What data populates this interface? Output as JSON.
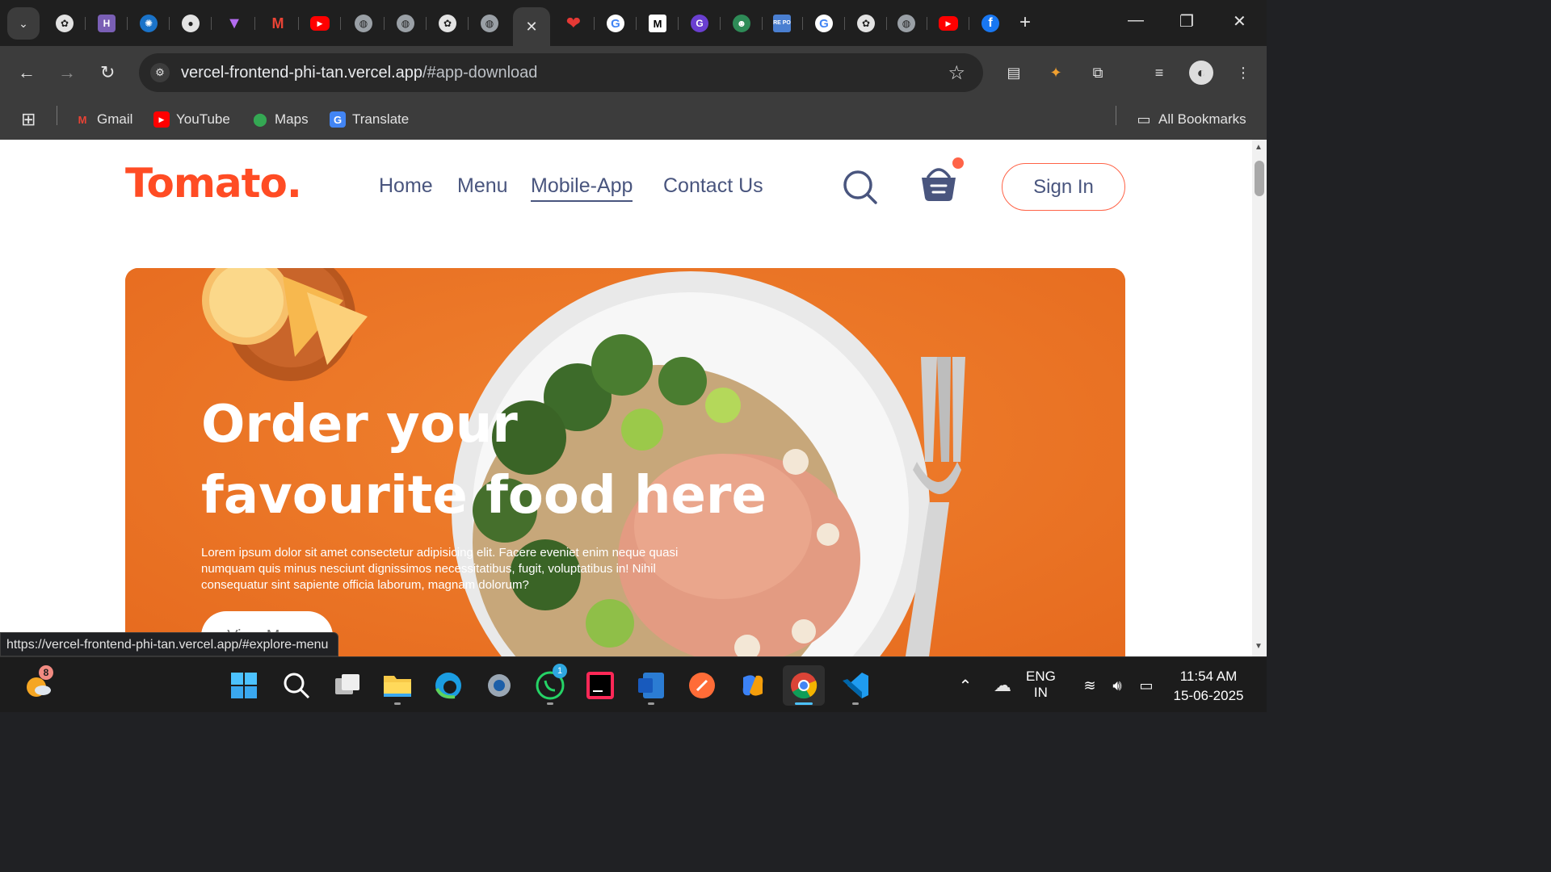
{
  "browser": {
    "tabs": [
      {
        "icon": "chatgpt-icon",
        "label": ""
      },
      {
        "icon": "hostinger-icon",
        "label": "H"
      },
      {
        "icon": "blue-circle-icon",
        "label": ""
      },
      {
        "icon": "github-icon",
        "label": ""
      },
      {
        "icon": "vite-icon",
        "label": ""
      },
      {
        "icon": "gmail-icon",
        "label": "M"
      },
      {
        "icon": "youtube-icon",
        "label": "▶"
      },
      {
        "icon": "globe-icon",
        "label": ""
      },
      {
        "icon": "globe-icon",
        "label": ""
      },
      {
        "icon": "chatgpt-icon",
        "label": ""
      },
      {
        "icon": "globe-icon",
        "label": ""
      },
      {
        "icon": "close-icon",
        "label": "✕"
      },
      {
        "icon": "heart-icon",
        "label": "❤"
      },
      {
        "icon": "google-icon",
        "label": "G"
      },
      {
        "icon": "medium-icon",
        "label": "M"
      },
      {
        "icon": "circle-g-icon",
        "label": "G"
      },
      {
        "icon": "mascot-icon",
        "label": ""
      },
      {
        "icon": "repo-icon",
        "label": "RE PO"
      },
      {
        "icon": "google-icon",
        "label": "G"
      },
      {
        "icon": "chatgpt-icon",
        "label": ""
      },
      {
        "icon": "globe-icon",
        "label": ""
      },
      {
        "icon": "youtube-icon",
        "label": "▶"
      },
      {
        "icon": "facebook-icon",
        "label": "f"
      }
    ],
    "new_tab": "+",
    "window_controls": {
      "minimize": "—",
      "restore": "❐",
      "close": "✕"
    },
    "url": {
      "host": "vercel-frontend-phi-tan.vercel.app",
      "path": "/#app-download"
    },
    "bookmarks": [
      {
        "icon": "gmail-icon",
        "label": "Gmail"
      },
      {
        "icon": "youtube-icon",
        "label": "YouTube"
      },
      {
        "icon": "maps-icon",
        "label": "Maps"
      },
      {
        "icon": "translate-icon",
        "label": "Translate"
      }
    ],
    "all_bookmarks": "All Bookmarks",
    "status_url": "https://vercel-frontend-phi-tan.vercel.app/#explore-menu"
  },
  "site": {
    "logo": "Tomato.",
    "nav": [
      "Home",
      "Menu",
      "Mobile-App",
      "Contact Us"
    ],
    "active_nav": "Mobile-App",
    "sign_in": "Sign In",
    "hero": {
      "title_line1": "Order your",
      "title_line2": "favourite food here",
      "text": "Lorem ipsum dolor sit amet consectetur adipisicing elit. Facere eveniet enim neque quasi numquam quis minus nesciunt dignissimos necessitatibus, fugit, voluptatibus in! Nihil consequatur sint sapiente officia laborum, magnam dolorum?",
      "button": "View Menu"
    },
    "colors": {
      "brand": "#ff4c24",
      "nav_text": "#49557e",
      "hero_bg": "#ef7a2a"
    }
  },
  "taskbar": {
    "weather_badge": "8",
    "whatsapp_badge": "1",
    "lang_line1": "ENG",
    "lang_line2": "IN",
    "time": "11:54 AM",
    "date": "15-06-2025"
  }
}
